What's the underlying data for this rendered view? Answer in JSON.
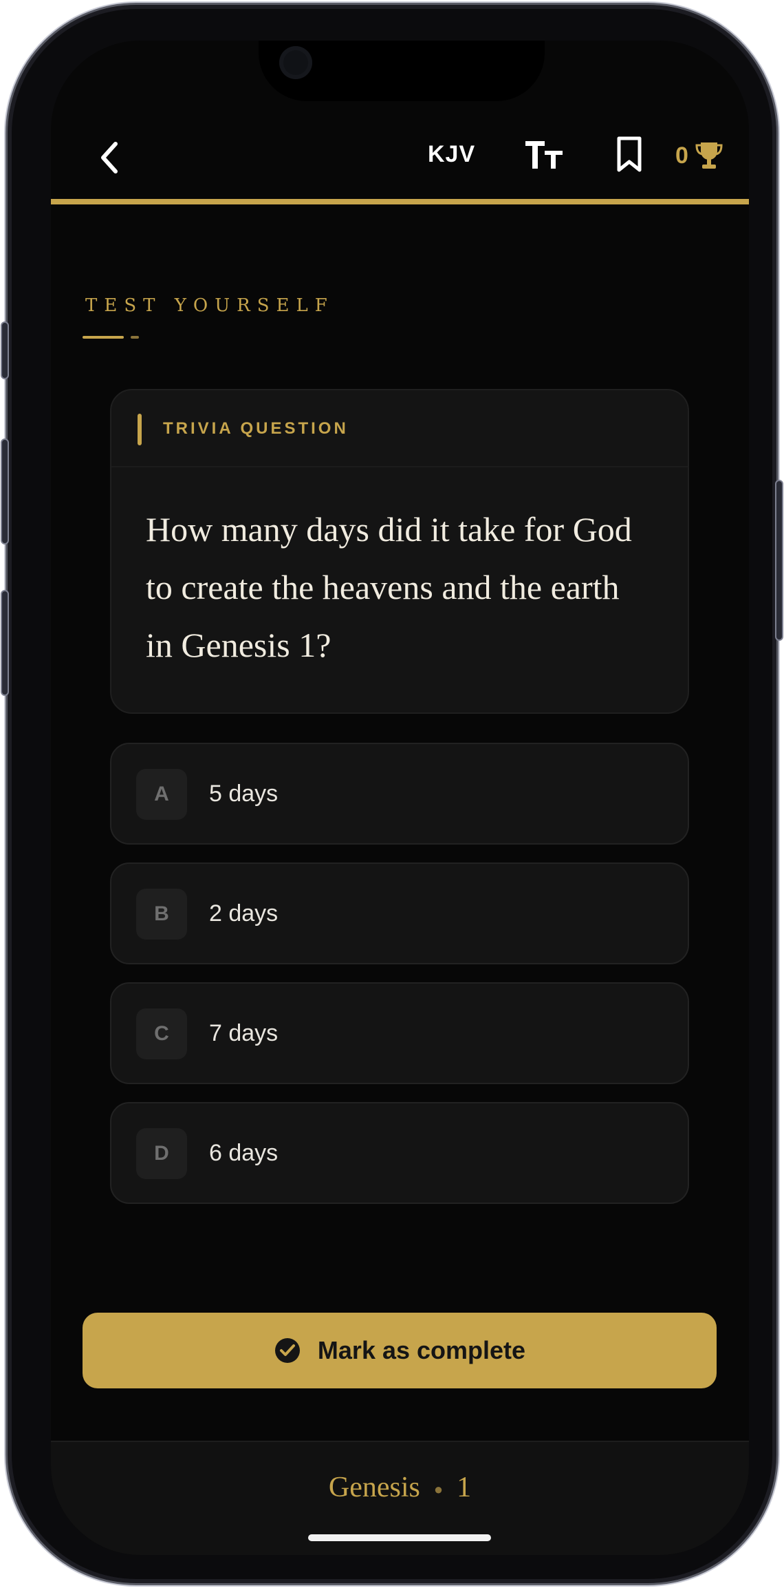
{
  "header": {
    "translation_label": "KJV",
    "score_value": "0",
    "reading_progress_fraction": 1.0
  },
  "section": {
    "title": "TEST YOURSELF"
  },
  "question_card": {
    "label": "TRIVIA QUESTION",
    "question": "How many days did it take for God to create the heavens and the earth in Genesis 1?"
  },
  "options": [
    {
      "letter": "A",
      "text": "5 days"
    },
    {
      "letter": "B",
      "text": "2 days"
    },
    {
      "letter": "C",
      "text": "7 days"
    },
    {
      "letter": "D",
      "text": "6 days"
    }
  ],
  "actions": {
    "complete_label": "Mark as complete"
  },
  "footer": {
    "book": "Genesis",
    "chapter": "1"
  },
  "icons": {
    "back": "chevron-left-icon",
    "text_size": "text-size-icon",
    "bookmark": "bookmark-icon",
    "score": "trophy-icon",
    "complete": "check-circle-icon"
  },
  "colors": {
    "accent": "#c7a54c",
    "background": "#070707",
    "card": "#141414"
  }
}
